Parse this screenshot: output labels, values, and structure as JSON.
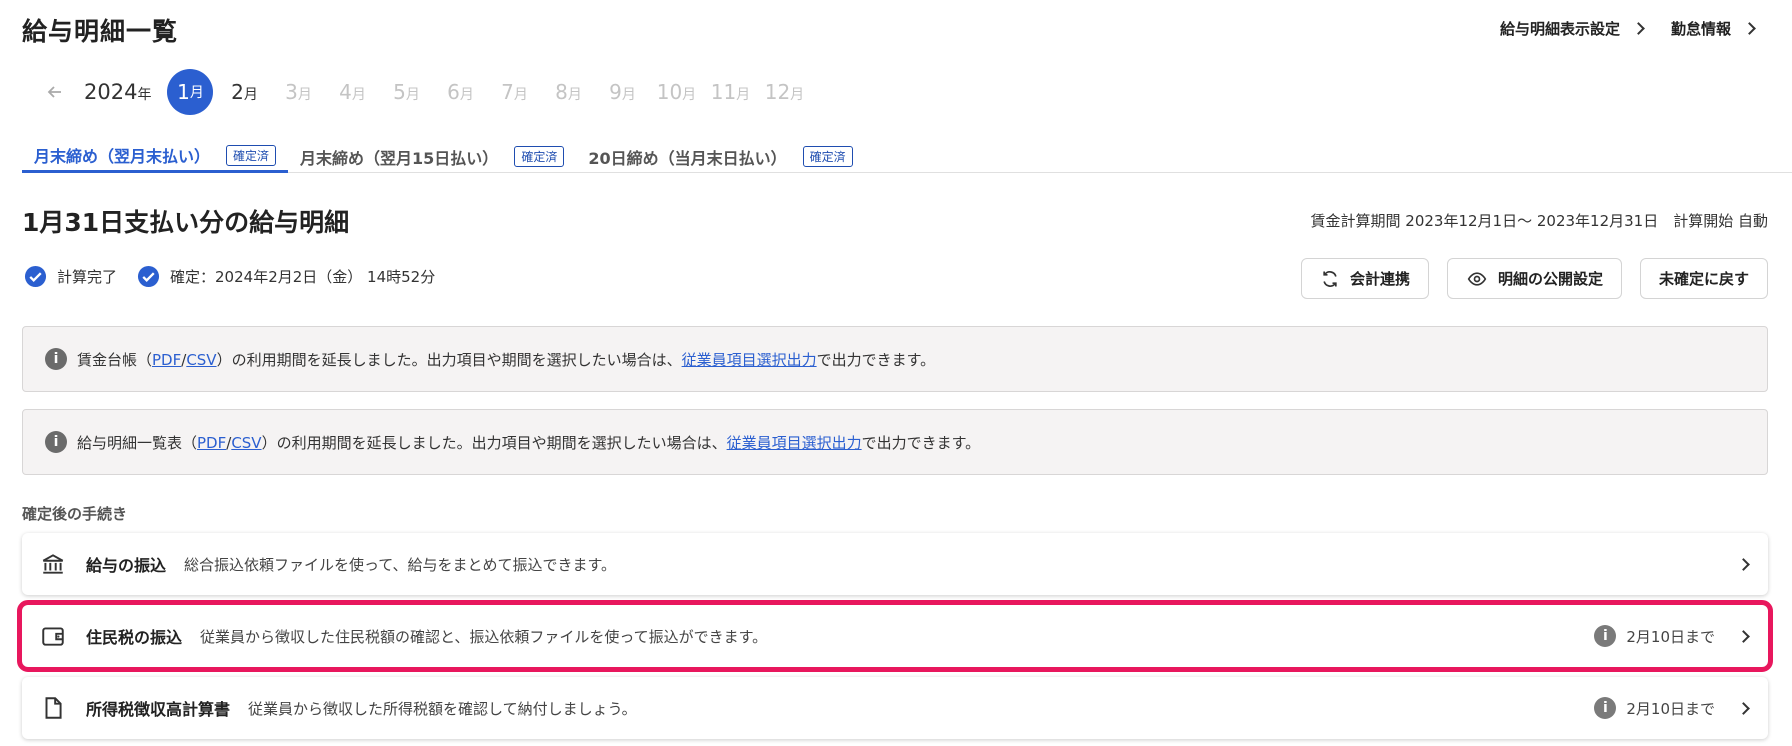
{
  "header": {
    "title": "給与明細一覧",
    "links": [
      "給与明細表示設定",
      "勤怠情報"
    ]
  },
  "month_nav": {
    "year": "2024",
    "year_unit": "年",
    "month_unit": "月",
    "months": [
      {
        "num": "1",
        "state": "active"
      },
      {
        "num": "2",
        "state": "enabled"
      },
      {
        "num": "3",
        "state": "disabled"
      },
      {
        "num": "4",
        "state": "disabled"
      },
      {
        "num": "5",
        "state": "disabled"
      },
      {
        "num": "6",
        "state": "disabled"
      },
      {
        "num": "7",
        "state": "disabled"
      },
      {
        "num": "8",
        "state": "disabled"
      },
      {
        "num": "9",
        "state": "disabled"
      },
      {
        "num": "10",
        "state": "disabled"
      },
      {
        "num": "11",
        "state": "disabled"
      },
      {
        "num": "12",
        "state": "disabled"
      }
    ]
  },
  "tabs": [
    {
      "label": "月末締め（翌月末払い）",
      "badge": "確定済",
      "active": true
    },
    {
      "label": "月末締め（翌月15日払い）",
      "badge": "確定済",
      "active": false
    },
    {
      "label": "20日締め（当月末日払い）",
      "badge": "確定済",
      "active": false
    }
  ],
  "main": {
    "title": "1月31日支払い分の給与明細",
    "period": "賃金計算期間 2023年12月1日〜 2023年12月31日　計算開始 自動",
    "status": [
      "計算完了",
      "確定：2024年2月2日（金） 14時52分"
    ],
    "actions": [
      "会計連携",
      "明細の公開設定",
      "未確定に戻す"
    ]
  },
  "notices": [
    {
      "prefix": "賃金台帳（",
      "link1": "PDF",
      "sep": "/",
      "link2": "CSV",
      "middle": "）の利用期間を延長しました。出力項目や期間を選択したい場合は、",
      "link3": "従業員項目選択出力",
      "suffix": "で出力できます。"
    },
    {
      "prefix": "給与明細一覧表（",
      "link1": "PDF",
      "sep": "/",
      "link2": "CSV",
      "middle": "）の利用期間を延長しました。出力項目や期間を選択したい場合は、",
      "link3": "従業員項目選択出力",
      "suffix": "で出力できます。"
    }
  ],
  "procedures": {
    "label": "確定後の手続き",
    "items": [
      {
        "icon": "bank-icon",
        "title": "給与の振込",
        "desc": "総合振込依頼ファイルを使って、給与をまとめて振込できます。",
        "due": ""
      },
      {
        "icon": "wallet-icon",
        "title": "住民税の振込",
        "desc": "従業員から徴収した住民税額の確認と、振込依頼ファイルを使って振込ができます。",
        "due": "2月10日まで"
      },
      {
        "icon": "document-icon",
        "title": "所得税徴収高計算書",
        "desc": "従業員から徴収した所得税額を確認して納付しましょう。",
        "due": "2月10日まで"
      }
    ]
  },
  "colors": {
    "accent": "#2b5fd0",
    "highlight": "#e8175d"
  }
}
